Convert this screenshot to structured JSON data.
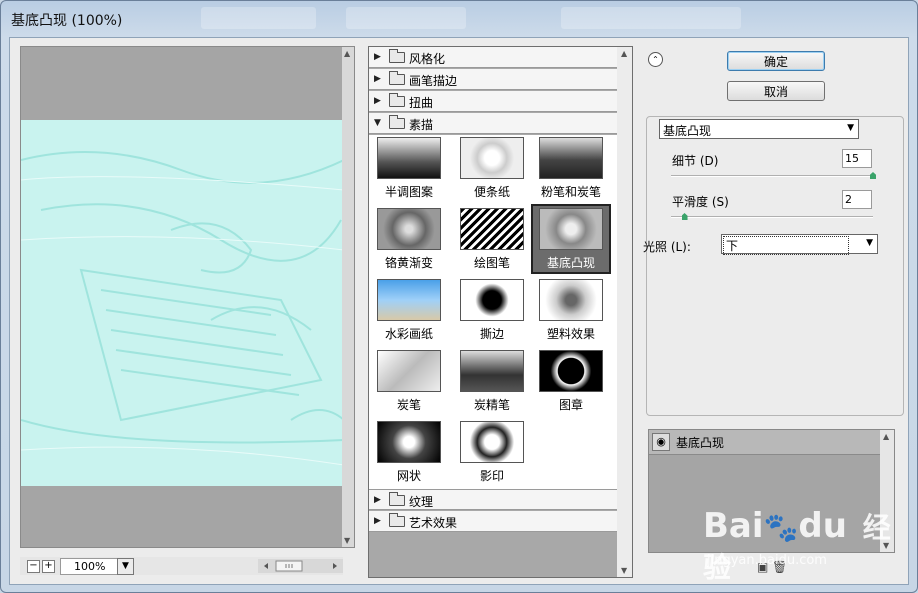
{
  "window": {
    "title": "基底凸现 (100%)"
  },
  "preview": {
    "zoom": "100%",
    "zoom_minus": "−",
    "zoom_plus": "+"
  },
  "gallery": {
    "categories_top": [
      "风格化",
      "画笔描边",
      "扭曲"
    ],
    "open_category": "素描",
    "filters": [
      "半调图案",
      "便条纸",
      "粉笔和炭笔",
      "铬黄渐变",
      "绘图笔",
      "基底凸现",
      "水彩画纸",
      "撕边",
      "塑料效果",
      "炭笔",
      "炭精笔",
      "图章",
      "网状",
      "影印"
    ],
    "selected_filter": "基底凸现",
    "categories_bottom": [
      "纹理",
      "艺术效果"
    ]
  },
  "buttons": {
    "ok": "确定",
    "cancel": "取消"
  },
  "settings": {
    "filter_select": "基底凸现",
    "detail_label": "细节 (D)",
    "detail_value": "15",
    "detail_level": 1.0,
    "smooth_label": "平滑度 (S)",
    "smooth_value": "2",
    "smooth_level": 0.067,
    "light_label": "光照 (L):",
    "light_value": "下"
  },
  "layers": {
    "items": [
      "基底凸现"
    ]
  },
  "watermark": {
    "brand": "Bai",
    "brand_right": "du",
    "product": "经验",
    "url": "jingyan.baidu.com"
  },
  "colors": {
    "preview_tint": "#c8f2ee",
    "selection": "#6c6c6c",
    "slider_thumb": "#3aa36a"
  }
}
